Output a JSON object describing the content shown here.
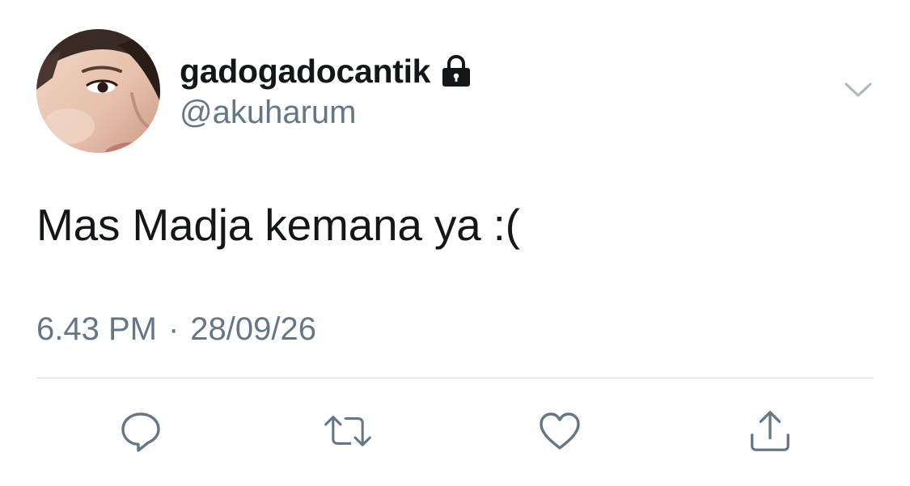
{
  "tweet": {
    "author": {
      "display_name": "gadogadocantik",
      "handle": "@akuharum",
      "protected_icon": "lock-icon",
      "avatar": "profile-photo"
    },
    "text": "Mas Madja kemana ya :(",
    "time": "6.43 PM",
    "separator": "·",
    "date": "28/09/26",
    "menu_icon": "chevron-down-icon",
    "actions": [
      {
        "name": "reply",
        "icon": "comment-icon"
      },
      {
        "name": "retweet",
        "icon": "retweet-icon"
      },
      {
        "name": "like",
        "icon": "heart-icon"
      },
      {
        "name": "share",
        "icon": "share-icon"
      }
    ],
    "colors": {
      "text": "#14171a",
      "secondary": "#657786",
      "divider": "#d5dbe0",
      "icon": "#657786"
    }
  }
}
